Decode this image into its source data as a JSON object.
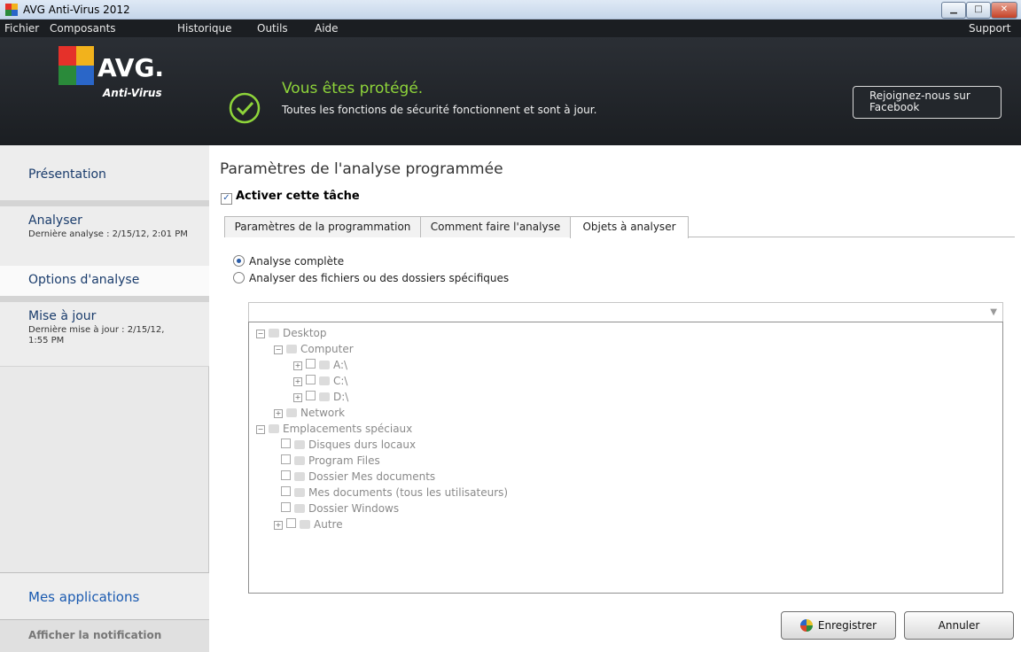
{
  "window": {
    "title": "AVG Anti-Virus 2012"
  },
  "menu": {
    "items": [
      "Fichier",
      "Composants",
      "Historique",
      "Outils",
      "Aide"
    ],
    "support": "Support"
  },
  "header": {
    "logo_text": "AVG.",
    "logo_sub": "Anti-Virus",
    "status_title": "Vous êtes protégé.",
    "status_sub": "Toutes les fonctions de sécurité fonctionnent et sont à jour.",
    "facebook_button": "Rejoignez-nous sur Facebook",
    "accent": "#8ed43a"
  },
  "sidebar": {
    "presentation": "Présentation",
    "analyser": {
      "label": "Analyser",
      "sub": "Dernière analyse : 2/15/12, 2:01 PM"
    },
    "options": "Options d'analyse",
    "update": {
      "label": "Mise à jour",
      "sub": "Dernière mise à jour : 2/15/12, 1:55 PM"
    },
    "apps": "Mes applications",
    "notification": "Afficher la notification"
  },
  "content": {
    "title": "Paramètres de l'analyse programmée",
    "enable_label": "Activer cette tâche",
    "enable_checked": true,
    "tabs": [
      "Paramètres de la programmation",
      "Comment faire l'analyse",
      "Objets à analyser"
    ],
    "active_tab": 2,
    "radio_full": "Analyse complète",
    "radio_specific": "Analyser des fichiers ou des dossiers spécifiques",
    "selected_radio": "full",
    "combo_value": "",
    "tree": {
      "desktop": "Desktop",
      "computer": "Computer",
      "drive_a": "A:\\",
      "drive_c": "C:\\",
      "drive_d": "D:\\",
      "network": "Network",
      "special": "Emplacements spéciaux",
      "local_disks": "Disques durs locaux",
      "program_files": "Program Files",
      "my_docs": "Dossier Mes documents",
      "all_docs": "Mes documents (tous les utilisateurs)",
      "windows": "Dossier Windows",
      "other": "Autre"
    }
  },
  "buttons": {
    "save": "Enregistrer",
    "cancel": "Annuler"
  }
}
